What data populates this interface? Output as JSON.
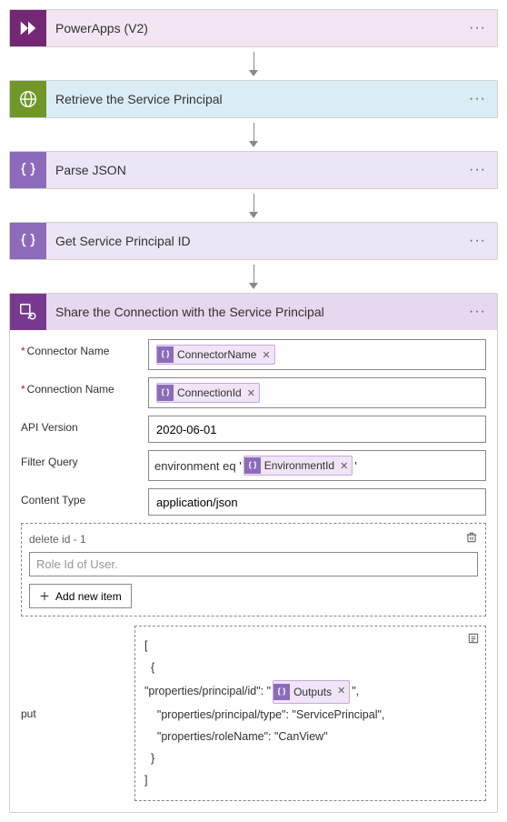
{
  "steps": {
    "powerapps": {
      "title": "PowerApps (V2)"
    },
    "retrieve": {
      "title": "Retrieve the Service Principal"
    },
    "parse": {
      "title": "Parse JSON"
    },
    "getid": {
      "title": "Get Service Principal ID"
    },
    "share": {
      "title": "Share the Connection with the Service Principal"
    }
  },
  "labels": {
    "connector_name": "Connector Name",
    "connection_name": "Connection Name",
    "api_version": "API Version",
    "filter_query": "Filter Query",
    "content_type": "Content Type",
    "delete_section": "delete id - 1",
    "role_placeholder": "Role Id of User.",
    "add_new": "Add new item",
    "put": "put",
    "required": "*"
  },
  "values": {
    "connector_token": "ConnectorName",
    "connection_token": "ConnectionId",
    "api_version": "2020-06-01",
    "filter_prefix": "environment eq '",
    "environment_token": "EnvironmentId",
    "content_type": "application/json",
    "outputs_token": "Outputs",
    "put_json": {
      "open_bracket": "[",
      "open_brace": "  {",
      "l1_a": "    \"properties/principal/id\": \"",
      "l1_b": "\",",
      "l2": "    \"properties/principal/type\": \"ServicePrincipal\",",
      "l3": "    \"properties/roleName\": \"CanView\"",
      "close_brace": "  }",
      "close_bracket": "]"
    }
  },
  "icons": {
    "clipboard": "clipboard-icon",
    "delete": "delete-icon"
  }
}
